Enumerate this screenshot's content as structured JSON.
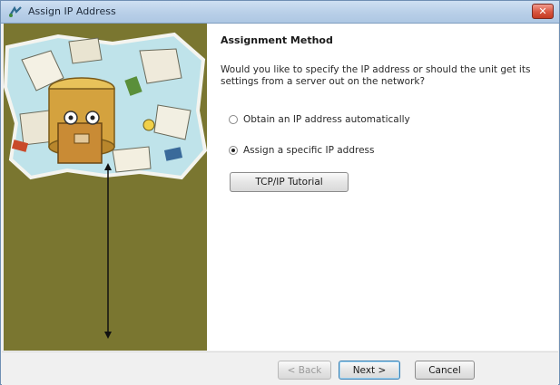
{
  "window": {
    "title": "Assign IP Address",
    "close_label": "✕"
  },
  "page": {
    "heading": "Assignment Method",
    "description": "Would you like to specify the IP address or should the unit get its settings from a server out on the network?"
  },
  "options": [
    {
      "label": "Obtain an IP address automatically",
      "checked": false
    },
    {
      "label": "Assign a specific IP address",
      "checked": true
    }
  ],
  "buttons": {
    "tutorial": "TCP/IP Tutorial",
    "back": "< Back",
    "next": "Next >",
    "cancel": "Cancel"
  },
  "colors": {
    "side_panel": "#7a7630",
    "titlebar": "#b8cfe8",
    "content_bg": "#ffffff"
  }
}
